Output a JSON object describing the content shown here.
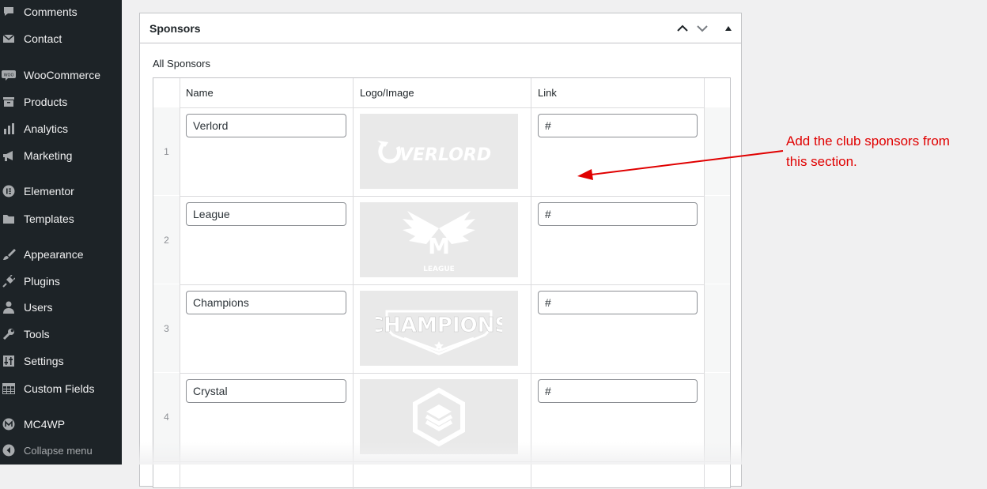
{
  "sidebar": {
    "items": [
      {
        "label": "Comments",
        "icon": "comments-icon"
      },
      {
        "label": "Contact",
        "icon": "mail-icon"
      },
      {
        "label": "WooCommerce",
        "icon": "woocommerce-icon"
      },
      {
        "label": "Products",
        "icon": "archive-icon"
      },
      {
        "label": "Analytics",
        "icon": "bar-chart-icon"
      },
      {
        "label": "Marketing",
        "icon": "megaphone-icon"
      },
      {
        "label": "Elementor",
        "icon": "elementor-icon"
      },
      {
        "label": "Templates",
        "icon": "folder-icon"
      },
      {
        "label": "Appearance",
        "icon": "paintbrush-icon"
      },
      {
        "label": "Plugins",
        "icon": "plug-icon"
      },
      {
        "label": "Users",
        "icon": "user-icon"
      },
      {
        "label": "Tools",
        "icon": "wrench-icon"
      },
      {
        "label": "Settings",
        "icon": "settings-sliders-icon"
      },
      {
        "label": "Custom Fields",
        "icon": "table-grid-icon"
      },
      {
        "label": "MC4WP",
        "icon": "mc4wp-icon"
      }
    ],
    "collapse_label": "Collapse menu"
  },
  "panel": {
    "title": "Sponsors",
    "section_label": "All Sponsors",
    "columns": [
      "Name",
      "Logo/Image",
      "Link"
    ],
    "rows": [
      {
        "num": "1",
        "name": "Verlord",
        "logo": "OVERLORD",
        "link": "#"
      },
      {
        "num": "2",
        "name": "League",
        "logo": "LEAGUE",
        "link": "#"
      },
      {
        "num": "3",
        "name": "Champions",
        "logo": "CHAMPIONS",
        "link": "#"
      },
      {
        "num": "4",
        "name": "Crystal",
        "logo": "crystal-hexagon-logo",
        "link": "#"
      }
    ]
  },
  "annotation": {
    "line1": "Add the club sponsors from",
    "line2": "this section.",
    "color": "#e00000"
  },
  "colors": {
    "sidebar_bg": "#1d2327",
    "page_bg": "#f0f0f1",
    "logo_bg": "#e9e9e9",
    "annotation": "#e00000"
  }
}
